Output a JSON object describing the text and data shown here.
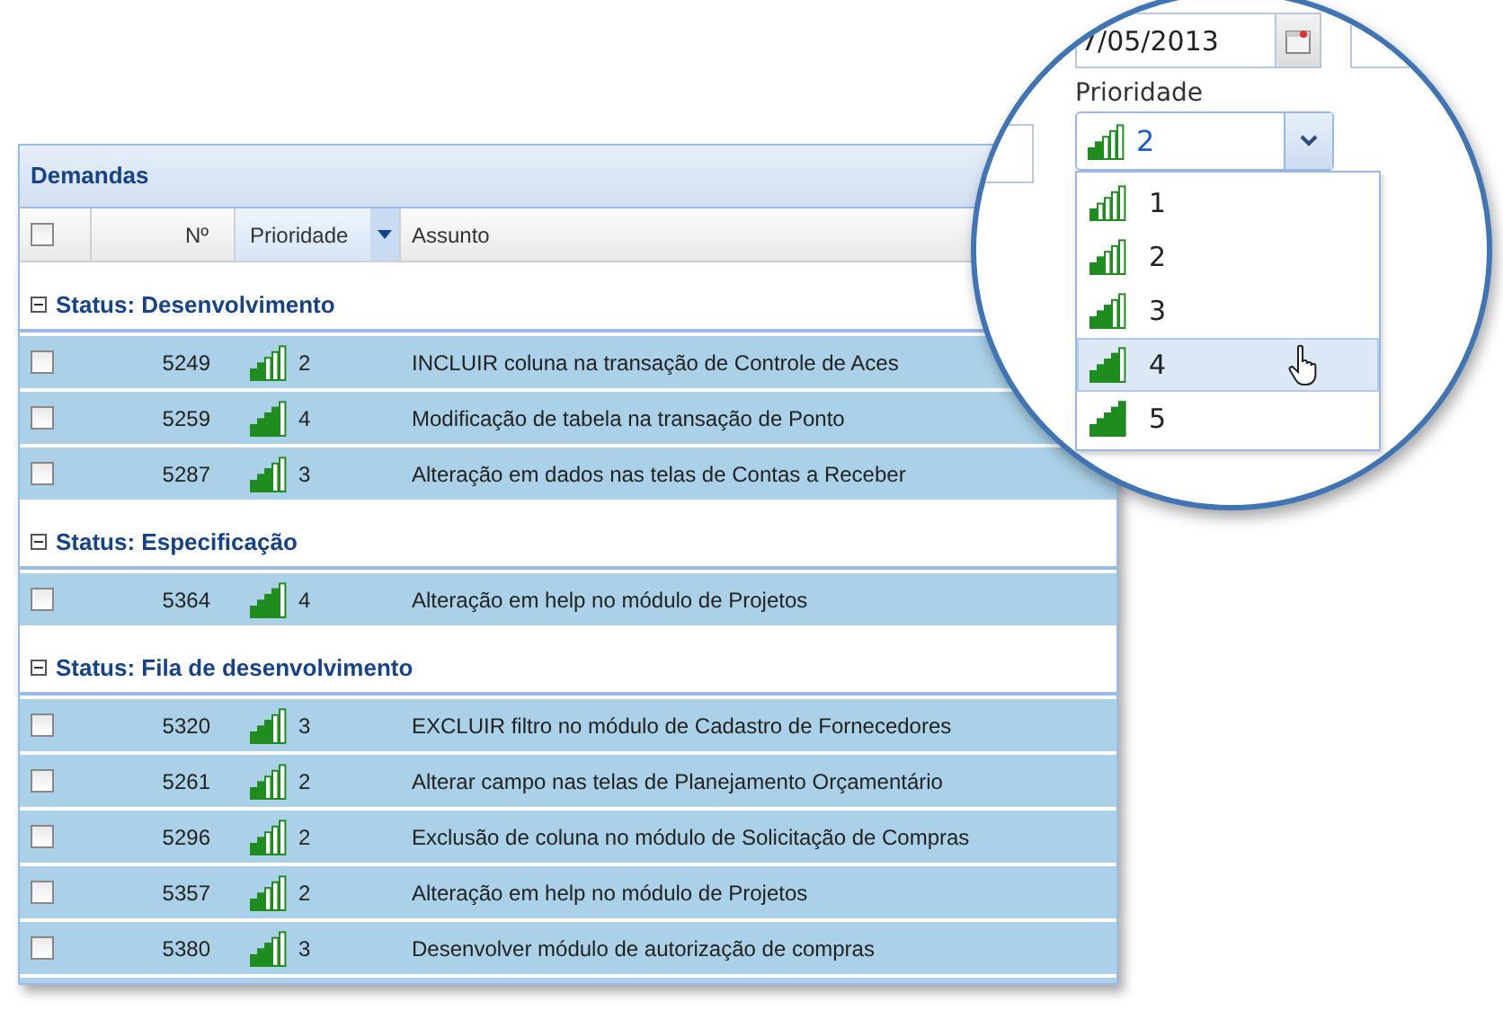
{
  "grid": {
    "title": "Demandas",
    "header": {
      "checked": false,
      "columns": [
        {
          "label": "Nº",
          "active": false
        },
        {
          "label": "Prioridade",
          "active": true
        },
        {
          "label": "Assunto",
          "active": false
        }
      ]
    },
    "groups": [
      {
        "label": "Status: Desenvolvimento",
        "expanded": true,
        "rows": [
          {
            "checked": false,
            "number": "5249",
            "level": 0.4,
            "priority": "2",
            "subject": "INCLUIR coluna na transação de Controle de Aces"
          },
          {
            "checked": false,
            "number": "5259",
            "level": 0.8,
            "priority": "4",
            "subject": "Modificação de tabela na transação de Ponto"
          },
          {
            "checked": false,
            "number": "5287",
            "level": 0.6,
            "priority": "3",
            "subject": "Alteração em dados nas telas de Contas a Receber"
          }
        ]
      },
      {
        "label": "Status: Especificação",
        "expanded": true,
        "rows": [
          {
            "checked": false,
            "number": "5364",
            "level": 0.8,
            "priority": "4",
            "subject": "Alteração em help no módulo de Projetos"
          }
        ]
      },
      {
        "label": "Status: Fila de desenvolvimento",
        "expanded": true,
        "rows": [
          {
            "checked": false,
            "number": "5320",
            "level": 0.6,
            "priority": "3",
            "subject": "EXCLUIR filtro no módulo de Cadastro de Fornecedores"
          },
          {
            "checked": false,
            "number": "5261",
            "level": 0.4,
            "priority": "2",
            "subject": "Alterar campo nas telas de Planejamento Orçamentário"
          },
          {
            "checked": false,
            "number": "5296",
            "level": 0.4,
            "priority": "2",
            "subject": "Exclusão de coluna no módulo de Solicitação de Compras"
          },
          {
            "checked": false,
            "number": "5357",
            "level": 0.4,
            "priority": "2",
            "subject": "Alteração em help no módulo de Projetos"
          },
          {
            "checked": false,
            "number": "5380",
            "level": 0.6,
            "priority": "3",
            "subject": "Desenvolver módulo de autorização de compras"
          }
        ]
      }
    ]
  },
  "magnifier": {
    "date_field": {
      "value": "7/05/2013"
    },
    "priority_label": "Prioridade",
    "priority_combo": {
      "value": "2",
      "level": 0.4
    },
    "options": [
      {
        "label": "1",
        "level": 0.2,
        "selected": false
      },
      {
        "label": "2",
        "level": 0.4,
        "selected": false
      },
      {
        "label": "3",
        "level": 0.6,
        "selected": false
      },
      {
        "label": "4",
        "level": 0.8,
        "selected": true
      },
      {
        "label": "5",
        "level": 1,
        "selected": false
      }
    ]
  }
}
